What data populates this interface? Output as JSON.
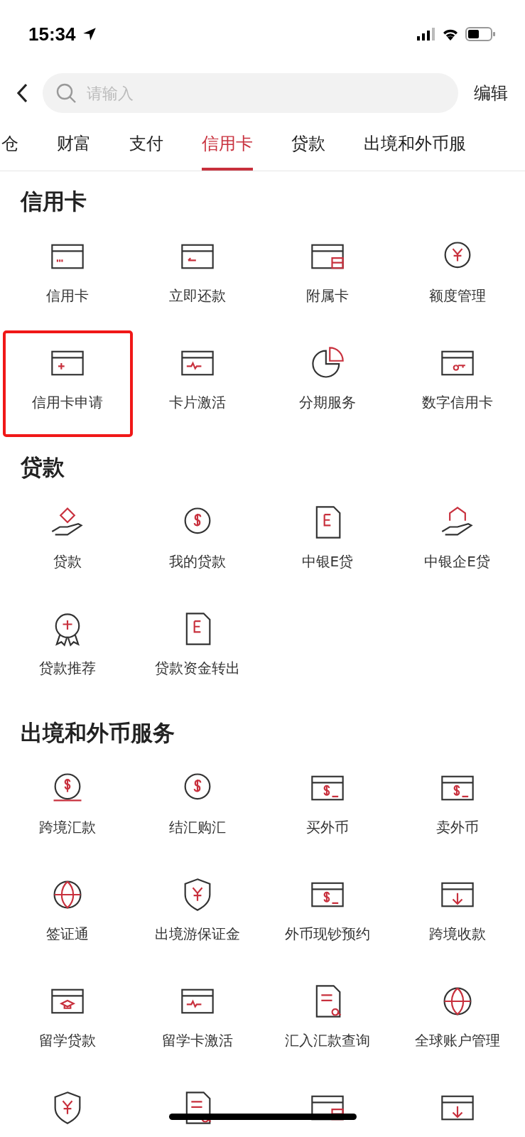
{
  "status_bar": {
    "time": "15:34"
  },
  "search": {
    "placeholder": "请输入",
    "action": "编辑"
  },
  "tabs": [
    {
      "label": "仓",
      "selected": false
    },
    {
      "label": "财富",
      "selected": false
    },
    {
      "label": "支付",
      "selected": false
    },
    {
      "label": "信用卡",
      "selected": true
    },
    {
      "label": "贷款",
      "selected": false
    },
    {
      "label": "出境和外币服",
      "selected": false
    }
  ],
  "sections": [
    {
      "title": "信用卡",
      "items": [
        {
          "label": "信用卡",
          "kind": "card",
          "highlighted": false
        },
        {
          "label": "立即还款",
          "kind": "card-return",
          "highlighted": false
        },
        {
          "label": "附属卡",
          "kind": "card-sub",
          "highlighted": false
        },
        {
          "label": "额度管理",
          "kind": "yen-coin",
          "highlighted": false
        },
        {
          "label": "信用卡申请",
          "kind": "card-plus",
          "highlighted": true
        },
        {
          "label": "卡片激活",
          "kind": "card-pulse",
          "highlighted": false
        },
        {
          "label": "分期服务",
          "kind": "pie",
          "highlighted": false
        },
        {
          "label": "数字信用卡",
          "kind": "card-key",
          "highlighted": false
        }
      ]
    },
    {
      "title": "贷款",
      "items": [
        {
          "label": "贷款",
          "kind": "hand-diamond",
          "highlighted": false
        },
        {
          "label": "我的贷款",
          "kind": "loan-coin",
          "highlighted": false
        },
        {
          "label": "中银E贷",
          "kind": "e-doc",
          "highlighted": false
        },
        {
          "label": "中银企E贷",
          "kind": "hand-house",
          "highlighted": false
        },
        {
          "label": "贷款推荐",
          "kind": "loan-badge",
          "highlighted": false
        },
        {
          "label": "贷款资金转出",
          "kind": "e-doc",
          "highlighted": false
        }
      ]
    },
    {
      "title": "出境和外币服务",
      "items": [
        {
          "label": "跨境汇款",
          "kind": "dollar-tray",
          "highlighted": false
        },
        {
          "label": "结汇购汇",
          "kind": "dollar-coin",
          "highlighted": false
        },
        {
          "label": "买外币",
          "kind": "dollar-card",
          "highlighted": false
        },
        {
          "label": "卖外币",
          "kind": "dollar-card",
          "highlighted": false
        },
        {
          "label": "签证通",
          "kind": "globe",
          "highlighted": false
        },
        {
          "label": "出境游保证金",
          "kind": "shield",
          "highlighted": false
        },
        {
          "label": "外币现钞预约",
          "kind": "dollar-card",
          "highlighted": false
        },
        {
          "label": "跨境收款",
          "kind": "dollar-down",
          "highlighted": false
        },
        {
          "label": "留学贷款",
          "kind": "card-cap",
          "highlighted": false
        },
        {
          "label": "留学卡激活",
          "kind": "card-pulse",
          "highlighted": false
        },
        {
          "label": "汇入汇款查询",
          "kind": "doc-search",
          "highlighted": false
        },
        {
          "label": "全球账户管理",
          "kind": "globe",
          "highlighted": false
        },
        {
          "kind": "shield",
          "highlighted": false
        },
        {
          "kind": "doc-search",
          "highlighted": false
        },
        {
          "kind": "card-sub",
          "highlighted": false
        },
        {
          "kind": "dollar-down",
          "highlighted": false
        }
      ]
    }
  ]
}
